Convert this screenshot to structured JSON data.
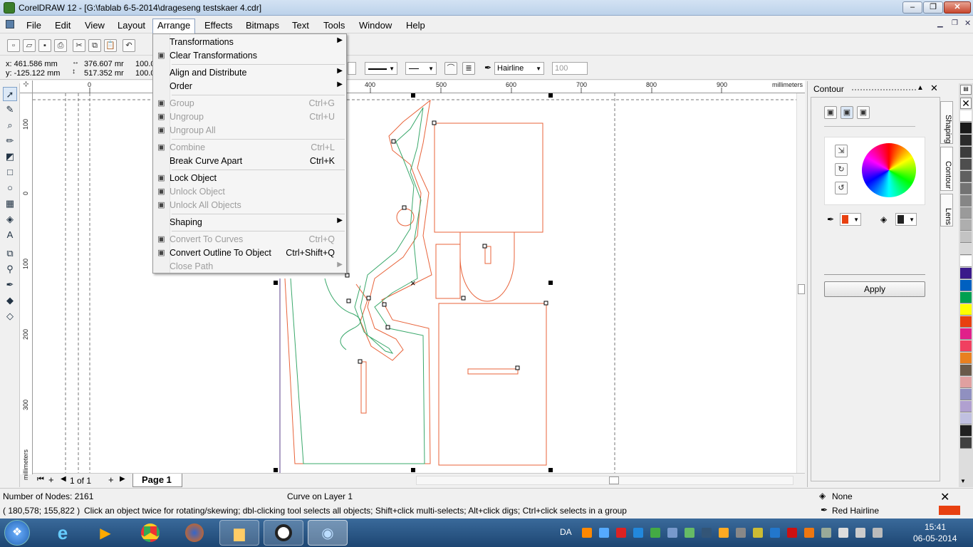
{
  "window": {
    "title": "CorelDRAW 12 - [G:\\fablab 6-5-2014\\drageseng testskaer 4.cdr]",
    "min": "–",
    "max": "❐",
    "close": "✕"
  },
  "menubar": {
    "items": [
      "File",
      "Edit",
      "View",
      "Layout",
      "Arrange",
      "Effects",
      "Bitmaps",
      "Text",
      "Tools",
      "Window",
      "Help"
    ],
    "active": "Arrange"
  },
  "arrange_menu": {
    "items": [
      {
        "label": "Transformations",
        "shortcut": "",
        "submenu": true,
        "disabled": false,
        "icon": "",
        "sep": false
      },
      {
        "label": "Clear Transformations",
        "shortcut": "",
        "submenu": false,
        "disabled": false,
        "icon": "clear-transform-icon",
        "sep": true
      },
      {
        "label": "Align and Distribute",
        "shortcut": "",
        "submenu": true,
        "disabled": false,
        "icon": "",
        "sep": false
      },
      {
        "label": "Order",
        "shortcut": "",
        "submenu": true,
        "disabled": false,
        "icon": "",
        "sep": true
      },
      {
        "label": "Group",
        "shortcut": "Ctrl+G",
        "submenu": false,
        "disabled": true,
        "icon": "group-icon",
        "sep": false
      },
      {
        "label": "Ungroup",
        "shortcut": "Ctrl+U",
        "submenu": false,
        "disabled": true,
        "icon": "ungroup-icon",
        "sep": false
      },
      {
        "label": "Ungroup All",
        "shortcut": "",
        "submenu": false,
        "disabled": true,
        "icon": "ungroup-all-icon",
        "sep": true
      },
      {
        "label": "Combine",
        "shortcut": "Ctrl+L",
        "submenu": false,
        "disabled": true,
        "icon": "combine-icon",
        "sep": false
      },
      {
        "label": "Break Curve Apart",
        "shortcut": "Ctrl+K",
        "submenu": false,
        "disabled": false,
        "icon": "",
        "sep": true
      },
      {
        "label": "Lock Object",
        "shortcut": "",
        "submenu": false,
        "disabled": false,
        "icon": "lock-icon",
        "sep": false
      },
      {
        "label": "Unlock Object",
        "shortcut": "",
        "submenu": false,
        "disabled": true,
        "icon": "unlock-icon",
        "sep": false
      },
      {
        "label": "Unlock All Objects",
        "shortcut": "",
        "submenu": false,
        "disabled": true,
        "icon": "unlock-all-icon",
        "sep": true
      },
      {
        "label": "Shaping",
        "shortcut": "",
        "submenu": true,
        "disabled": false,
        "icon": "",
        "sep": true
      },
      {
        "label": "Convert To Curves",
        "shortcut": "Ctrl+Q",
        "submenu": false,
        "disabled": true,
        "icon": "convert-curves-icon",
        "sep": false
      },
      {
        "label": "Convert Outline To Object",
        "shortcut": "Ctrl+Shift+Q",
        "submenu": false,
        "disabled": false,
        "icon": "convert-outline-icon",
        "sep": false
      },
      {
        "label": "Close Path",
        "shortcut": "",
        "submenu": true,
        "disabled": true,
        "icon": "",
        "sep": false
      }
    ]
  },
  "propbar": {
    "x": "x: 461.586 mm",
    "y": "y: -125.122 mm",
    "w": "376.607 mr",
    "h": "517.352 mr",
    "sx": "100.0",
    "sy": "100.0",
    "outline": "Hairline",
    "percent": "100"
  },
  "rulers": {
    "h_labels": [
      "0",
      "400",
      "500",
      "600",
      "700",
      "800",
      "900"
    ],
    "unit": "millimeters",
    "v_labels": [
      "100",
      "0",
      "100",
      "200",
      "300"
    ],
    "v_unit": "millimeters"
  },
  "pagenav": {
    "pages": "1 of 1",
    "tab": "Page 1"
  },
  "docker": {
    "title": "Contour",
    "apply": "Apply",
    "tabs": [
      "Shaping",
      "Contour",
      "Lens"
    ]
  },
  "status": {
    "nodes": "Number of Nodes: 2161",
    "layer": "Curve on Layer 1",
    "coords": "( 180,578; 155,822 )",
    "hint": "Click an object twice for rotating/skewing; dbl-clicking tool selects all objects; Shift+click multi-selects; Alt+click digs; Ctrl+click selects in a group",
    "fill": "None",
    "outline": "Red  Hairline"
  },
  "taskbar": {
    "lang": "DA",
    "time": "15:41",
    "date": "06-05-2014"
  },
  "colors": {
    "orange": "#e8633a",
    "green": "#3aa86b",
    "swatches": [
      "#ffffff",
      "#1a1a1a",
      "#2b2b2b",
      "#3c3c3c",
      "#4e4e4e",
      "#606060",
      "#737373",
      "#868686",
      "#9a9a9a",
      "#aeaeae",
      "#c3c3c3",
      "#d8d8d8",
      "#ffffff",
      "#3a1a8a",
      "#0060c0",
      "#00a050",
      "#ffff00",
      "#e84010",
      "#e0208a",
      "#f04060",
      "#e88020",
      "#6a5a4a",
      "#e0a0a0",
      "#9090c0",
      "#b0a0d0",
      "#c0c0e0",
      "#202020",
      "#404040"
    ]
  }
}
